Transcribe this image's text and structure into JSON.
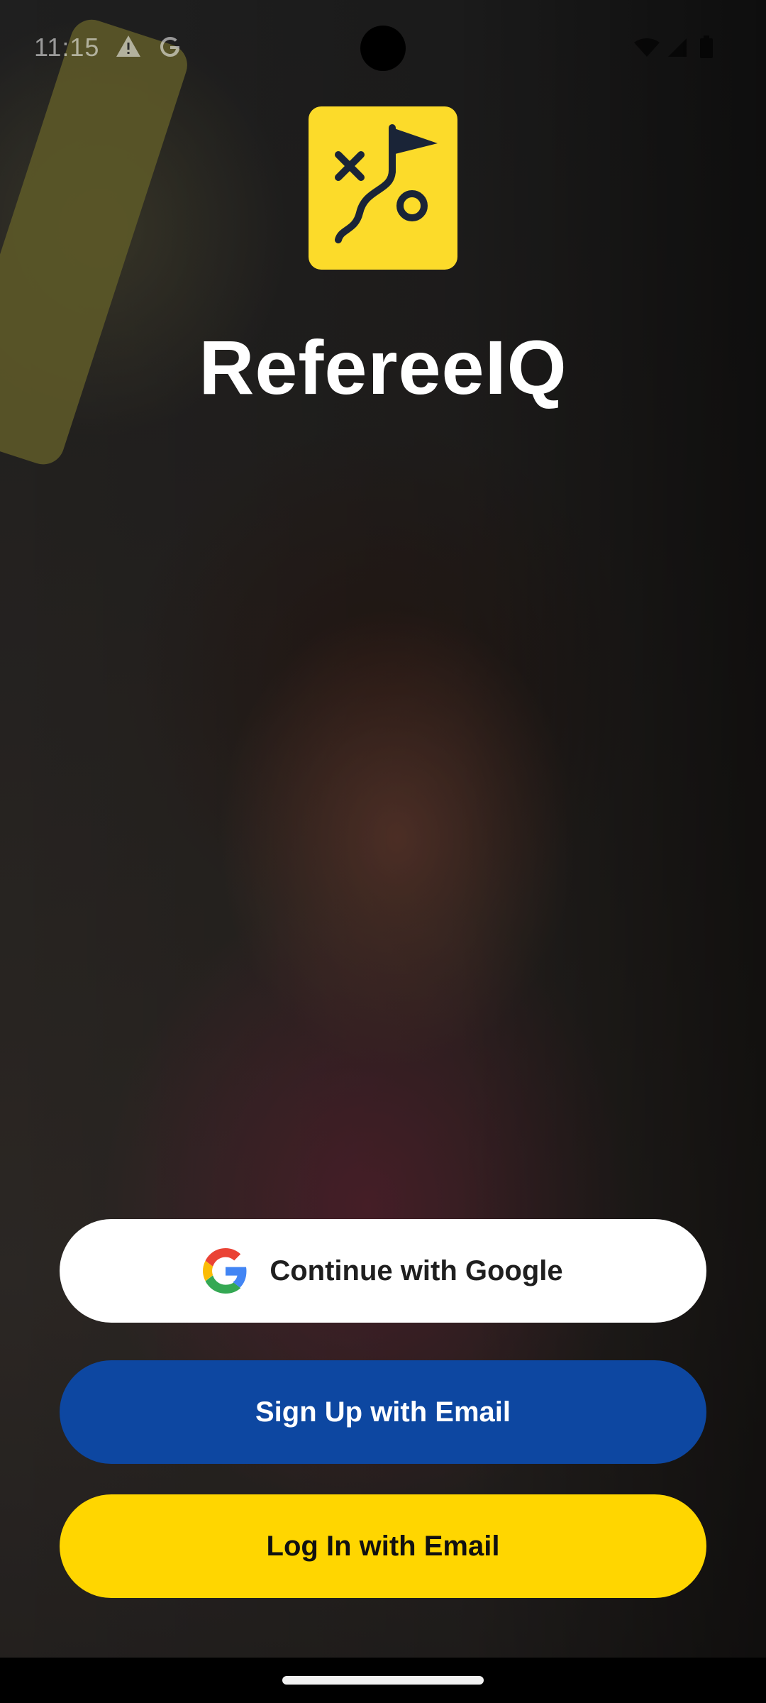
{
  "status_bar": {
    "time": "11:15",
    "icons": [
      "warning-icon",
      "google-g-icon",
      "wifi-icon",
      "signal-icon",
      "battery-icon"
    ]
  },
  "app": {
    "name": "RefereeIQ",
    "logo_icon": "playbook-flag-icon",
    "brand_yellow": "#FCDB2A"
  },
  "auth": {
    "google_label": "Continue with Google",
    "signup_label": "Sign Up with Email",
    "login_label": "Log In with Email"
  },
  "colors": {
    "signup_bg": "#0D47A1",
    "login_bg": "#FFD600",
    "google_bg": "#FFFFFF"
  }
}
